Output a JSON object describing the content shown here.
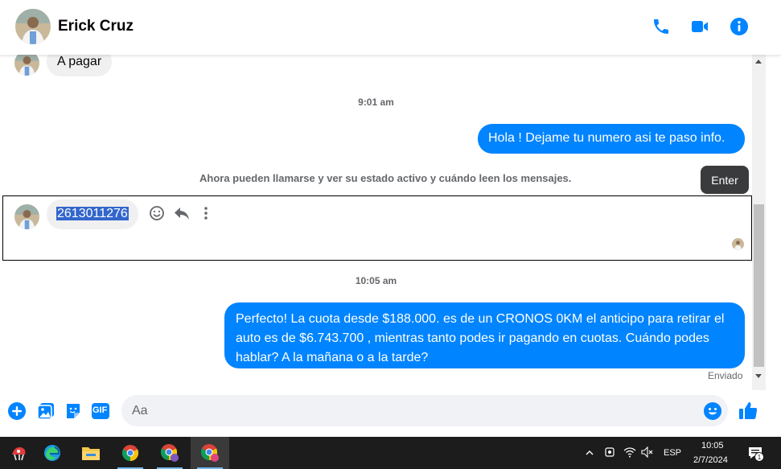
{
  "header": {
    "contact_name": "Erick Cruz",
    "icons": [
      "phone-icon",
      "video-icon",
      "info-icon"
    ],
    "accent": "#0084ff"
  },
  "messages": {
    "incoming_1": "A pagar",
    "time_1": "9:01 am",
    "outgoing_1": "Hola ! Dejame tu numero  asi te paso info.",
    "system_notice": "Ahora pueden llamarse y ver su estado activo y cuándo leen los mensajes.",
    "tooltip": "Enter",
    "incoming_2": "2613011276",
    "time_2": "10:05 am",
    "outgoing_2": "Perfecto! La cuota desde $188.000. es de un CRONOS 0KM el anticipo para retirar el auto es de $6.743.700 , mientras tanto podes ir pagando en cuotas. Cuándo podes hablar? A la mañana o a la tarde?",
    "status": "Enviado"
  },
  "composer": {
    "placeholder": "Aa",
    "icons": [
      "plus-icon",
      "image-icon",
      "sticker-icon",
      "gif-icon",
      "emoji-icon",
      "like-icon"
    ],
    "gif_label": "GIF"
  },
  "taskbar": {
    "apps": [
      "app-icon",
      "edge-icon",
      "file-explorer-icon",
      "chrome-icon",
      "chrome-profile-icon",
      "chrome-profile-c-icon"
    ],
    "language": "ESP",
    "time": "10:05",
    "date": "2/7/2024",
    "notification_count": "1"
  }
}
